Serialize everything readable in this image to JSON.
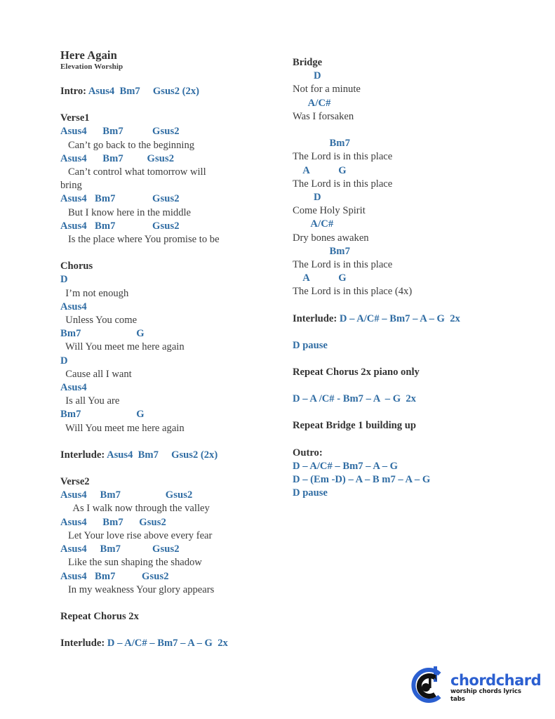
{
  "document": {
    "title": "Here Again",
    "artist": "Elevation Worship"
  },
  "left_column": {
    "intro": {
      "label": "Intro: ",
      "chords": "Asus4  Bm7     Gsus2 (2x)"
    },
    "verse1": {
      "heading": "Verse1",
      "lines": [
        {
          "chords": "Asus4      Bm7           Gsus2",
          "lyric": "   Can’t go back to the beginning"
        },
        {
          "chords": "Asus4      Bm7         Gsus2",
          "lyric": "   Can’t control what tomorrow will"
        },
        {
          "chords": "",
          "lyric": "bring"
        },
        {
          "chords": "Asus4   Bm7              Gsus2",
          "lyric": "   But I know here in the middle"
        },
        {
          "chords": "Asus4   Bm7              Gsus2",
          "lyric": "   Is the place where You promise to be"
        }
      ]
    },
    "chorus": {
      "heading": "Chorus",
      "lines": [
        {
          "chords": "D",
          "lyric": "  I’m not enough"
        },
        {
          "chords": "Asus4",
          "lyric": "  Unless You come"
        },
        {
          "chords": "Bm7                     G",
          "lyric": "  Will You meet me here again"
        },
        {
          "chords": "D",
          "lyric": "  Cause all I want"
        },
        {
          "chords": "Asus4",
          "lyric": "  Is all You are"
        },
        {
          "chords": "Bm7                     G",
          "lyric": "  Will You meet me here again"
        }
      ]
    },
    "interlude1": {
      "label": "Interlude: ",
      "chords": "Asus4  Bm7     Gsus2 (2x)"
    },
    "verse2": {
      "heading": "Verse2",
      "lines": [
        {
          "chords": "Asus4     Bm7                 Gsus2",
          "lyric": "     As I walk now through the valley"
        },
        {
          "chords": "Asus4      Bm7      Gsus2",
          "lyric": "   Let Your love rise above every fear"
        },
        {
          "chords": "Asus4     Bm7            Gsus2",
          "lyric": "   Like the sun shaping the shadow"
        },
        {
          "chords": "Asus4   Bm7          Gsus2",
          "lyric": "   In my weakness Your glory appears"
        }
      ]
    },
    "repeat_chorus": "Repeat Chorus 2x",
    "interlude2": {
      "label": "Interlude: ",
      "chords": "D – A/C# – Bm7 – A – G  2x"
    }
  },
  "right_column": {
    "bridge": {
      "heading": "Bridge",
      "lines": [
        {
          "chords": "        D",
          "lyric": "Not for a minute"
        },
        {
          "chords": "      A/C#",
          "lyric": "Was I forsaken"
        },
        {
          "chords": "",
          "lyric": ""
        },
        {
          "chords": "              Bm7",
          "lyric": "The Lord is in this place"
        },
        {
          "chords": "    A           G",
          "lyric": "The Lord is in this place"
        },
        {
          "chords": "        D",
          "lyric": "Come Holy Spirit"
        },
        {
          "chords": "       A/C#",
          "lyric": "Dry bones awaken"
        },
        {
          "chords": "              Bm7",
          "lyric": "The Lord is in this place"
        },
        {
          "chords": "    A           G",
          "lyric": "The Lord is in this place (4x)"
        }
      ],
      "last_line_suffix": "(4x)"
    },
    "interlude3": {
      "label": "Interlude: ",
      "chords": "D – A/C# – Bm7 – A – G  2x"
    },
    "d_pause_1": "D pause",
    "repeat_chorus_piano": "Repeat Chorus 2x piano only",
    "progression": "D – A /C# - Bm7 – A  – G  2x",
    "repeat_bridge": "Repeat Bridge 1 building up",
    "outro": {
      "heading": "Outro:",
      "lines": [
        "D – A/C# – Bm7 – A – G",
        "D – (Em -D) – A – B m7 – A – G",
        "D pause"
      ]
    }
  },
  "logo": {
    "word": "chordchard",
    "tagline": "worship chords lyrics tabs",
    "mark_text": "chordchard",
    "brand_color": "#2b5fd0"
  }
}
